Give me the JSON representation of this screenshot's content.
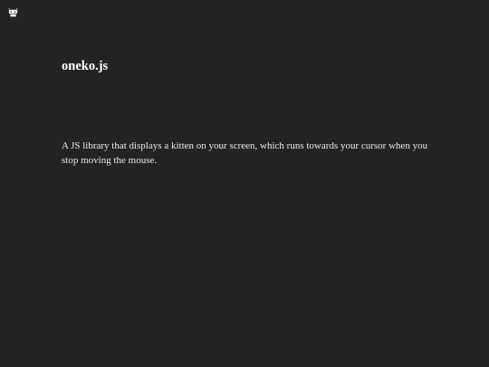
{
  "cursor_companion": {
    "icon": "kitten-icon",
    "colors": {
      "fur": "#f4f4f4",
      "outline": "#111111",
      "ears": "#e8a0b8"
    }
  },
  "page": {
    "title": "oneko.js",
    "description": "A JS library that displays a kitten on your screen, which runs towards your cursor when you stop moving the mouse.",
    "background_color": "#232323",
    "text_color": "#f2f2f2"
  }
}
